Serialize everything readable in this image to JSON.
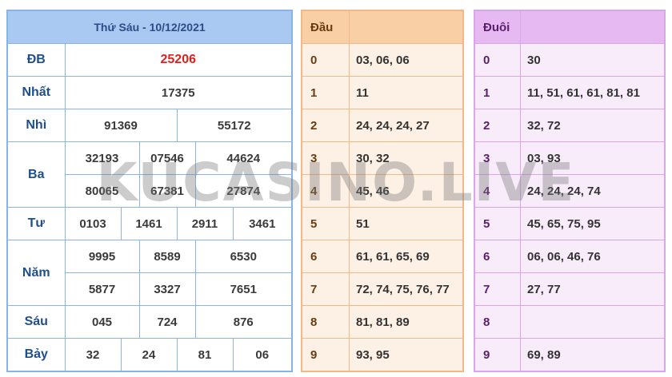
{
  "results": {
    "header": "Thứ Sáu - 10/12/2021",
    "labels": {
      "db": "ĐB",
      "nhat": "Nhất",
      "nhi": "Nhì",
      "ba": "Ba",
      "tu": "Tư",
      "nam": "Năm",
      "sau": "Sáu",
      "bay": "Bảy"
    },
    "db": "25206",
    "nhat": "17375",
    "nhi": [
      "91369",
      "55172"
    ],
    "ba": [
      "32193",
      "07546",
      "44624",
      "80065",
      "67381",
      "27874"
    ],
    "tu": [
      "0103",
      "1461",
      "2911",
      "3461"
    ],
    "nam": [
      "9995",
      "8589",
      "6530",
      "5877",
      "3327",
      "7651"
    ],
    "sau": [
      "045",
      "724",
      "876"
    ],
    "bay": [
      "32",
      "24",
      "81",
      "06"
    ]
  },
  "dau": {
    "header": "Đầu",
    "rows": [
      {
        "key": "0",
        "value": "03, 06, 06"
      },
      {
        "key": "1",
        "value": "11"
      },
      {
        "key": "2",
        "value": "24, 24, 24, 27"
      },
      {
        "key": "3",
        "value": "30, 32"
      },
      {
        "key": "4",
        "value": "45, 46"
      },
      {
        "key": "5",
        "value": "51"
      },
      {
        "key": "6",
        "value": "61, 61, 65, 69"
      },
      {
        "key": "7",
        "value": "72, 74, 75, 76, 77"
      },
      {
        "key": "8",
        "value": "81, 81, 89"
      },
      {
        "key": "9",
        "value": "93, 95"
      }
    ]
  },
  "duoi": {
    "header": "Đuôi",
    "rows": [
      {
        "key": "0",
        "value": "30"
      },
      {
        "key": "1",
        "value": "11, 51, 61, 61, 81, 81"
      },
      {
        "key": "2",
        "value": "32, 72"
      },
      {
        "key": "3",
        "value": "03, 93"
      },
      {
        "key": "4",
        "value": "24, 24, 24, 74"
      },
      {
        "key": "5",
        "value": "45, 65, 75, 95"
      },
      {
        "key": "6",
        "value": "06, 06, 46, 76"
      },
      {
        "key": "7",
        "value": "27, 77"
      },
      {
        "key": "8",
        "value": ""
      },
      {
        "key": "9",
        "value": "69, 89"
      }
    ]
  },
  "watermark": "KUCASINO.LIVE"
}
